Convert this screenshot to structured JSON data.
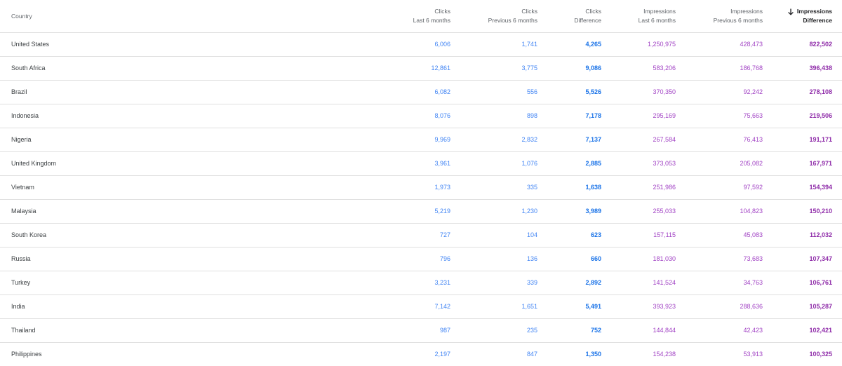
{
  "columns": {
    "country": "Country",
    "clicks_last": [
      "Clicks",
      "Last 6 months"
    ],
    "clicks_prev": [
      "Clicks",
      "Previous 6 months"
    ],
    "clicks_diff": [
      "Clicks",
      "Difference"
    ],
    "impr_last": [
      "Impressions",
      "Last 6 months"
    ],
    "impr_prev": [
      "Impressions",
      "Previous 6 months"
    ],
    "impr_diff": [
      "Impressions",
      "Difference"
    ]
  },
  "sort_icon": "arrow-down-icon",
  "colors": {
    "clicks": "#4285f4",
    "clicks_bold": "#1a73e8",
    "impressions": "#a142c4",
    "impressions_bold": "#8e2aa8"
  },
  "rows": [
    {
      "country": "United States",
      "clicks_last": "6,006",
      "clicks_prev": "1,741",
      "clicks_diff": "4,265",
      "impr_last": "1,250,975",
      "impr_prev": "428,473",
      "impr_diff": "822,502"
    },
    {
      "country": "South Africa",
      "clicks_last": "12,861",
      "clicks_prev": "3,775",
      "clicks_diff": "9,086",
      "impr_last": "583,206",
      "impr_prev": "186,768",
      "impr_diff": "396,438"
    },
    {
      "country": "Brazil",
      "clicks_last": "6,082",
      "clicks_prev": "556",
      "clicks_diff": "5,526",
      "impr_last": "370,350",
      "impr_prev": "92,242",
      "impr_diff": "278,108"
    },
    {
      "country": "Indonesia",
      "clicks_last": "8,076",
      "clicks_prev": "898",
      "clicks_diff": "7,178",
      "impr_last": "295,169",
      "impr_prev": "75,663",
      "impr_diff": "219,506"
    },
    {
      "country": "Nigeria",
      "clicks_last": "9,969",
      "clicks_prev": "2,832",
      "clicks_diff": "7,137",
      "impr_last": "267,584",
      "impr_prev": "76,413",
      "impr_diff": "191,171"
    },
    {
      "country": "United Kingdom",
      "clicks_last": "3,961",
      "clicks_prev": "1,076",
      "clicks_diff": "2,885",
      "impr_last": "373,053",
      "impr_prev": "205,082",
      "impr_diff": "167,971"
    },
    {
      "country": "Vietnam",
      "clicks_last": "1,973",
      "clicks_prev": "335",
      "clicks_diff": "1,638",
      "impr_last": "251,986",
      "impr_prev": "97,592",
      "impr_diff": "154,394"
    },
    {
      "country": "Malaysia",
      "clicks_last": "5,219",
      "clicks_prev": "1,230",
      "clicks_diff": "3,989",
      "impr_last": "255,033",
      "impr_prev": "104,823",
      "impr_diff": "150,210"
    },
    {
      "country": "South Korea",
      "clicks_last": "727",
      "clicks_prev": "104",
      "clicks_diff": "623",
      "impr_last": "157,115",
      "impr_prev": "45,083",
      "impr_diff": "112,032"
    },
    {
      "country": "Russia",
      "clicks_last": "796",
      "clicks_prev": "136",
      "clicks_diff": "660",
      "impr_last": "181,030",
      "impr_prev": "73,683",
      "impr_diff": "107,347"
    },
    {
      "country": "Turkey",
      "clicks_last": "3,231",
      "clicks_prev": "339",
      "clicks_diff": "2,892",
      "impr_last": "141,524",
      "impr_prev": "34,763",
      "impr_diff": "106,761"
    },
    {
      "country": "India",
      "clicks_last": "7,142",
      "clicks_prev": "1,651",
      "clicks_diff": "5,491",
      "impr_last": "393,923",
      "impr_prev": "288,636",
      "impr_diff": "105,287"
    },
    {
      "country": "Thailand",
      "clicks_last": "987",
      "clicks_prev": "235",
      "clicks_diff": "752",
      "impr_last": "144,844",
      "impr_prev": "42,423",
      "impr_diff": "102,421"
    },
    {
      "country": "Philippines",
      "clicks_last": "2,197",
      "clicks_prev": "847",
      "clicks_diff": "1,350",
      "impr_last": "154,238",
      "impr_prev": "53,913",
      "impr_diff": "100,325"
    }
  ]
}
